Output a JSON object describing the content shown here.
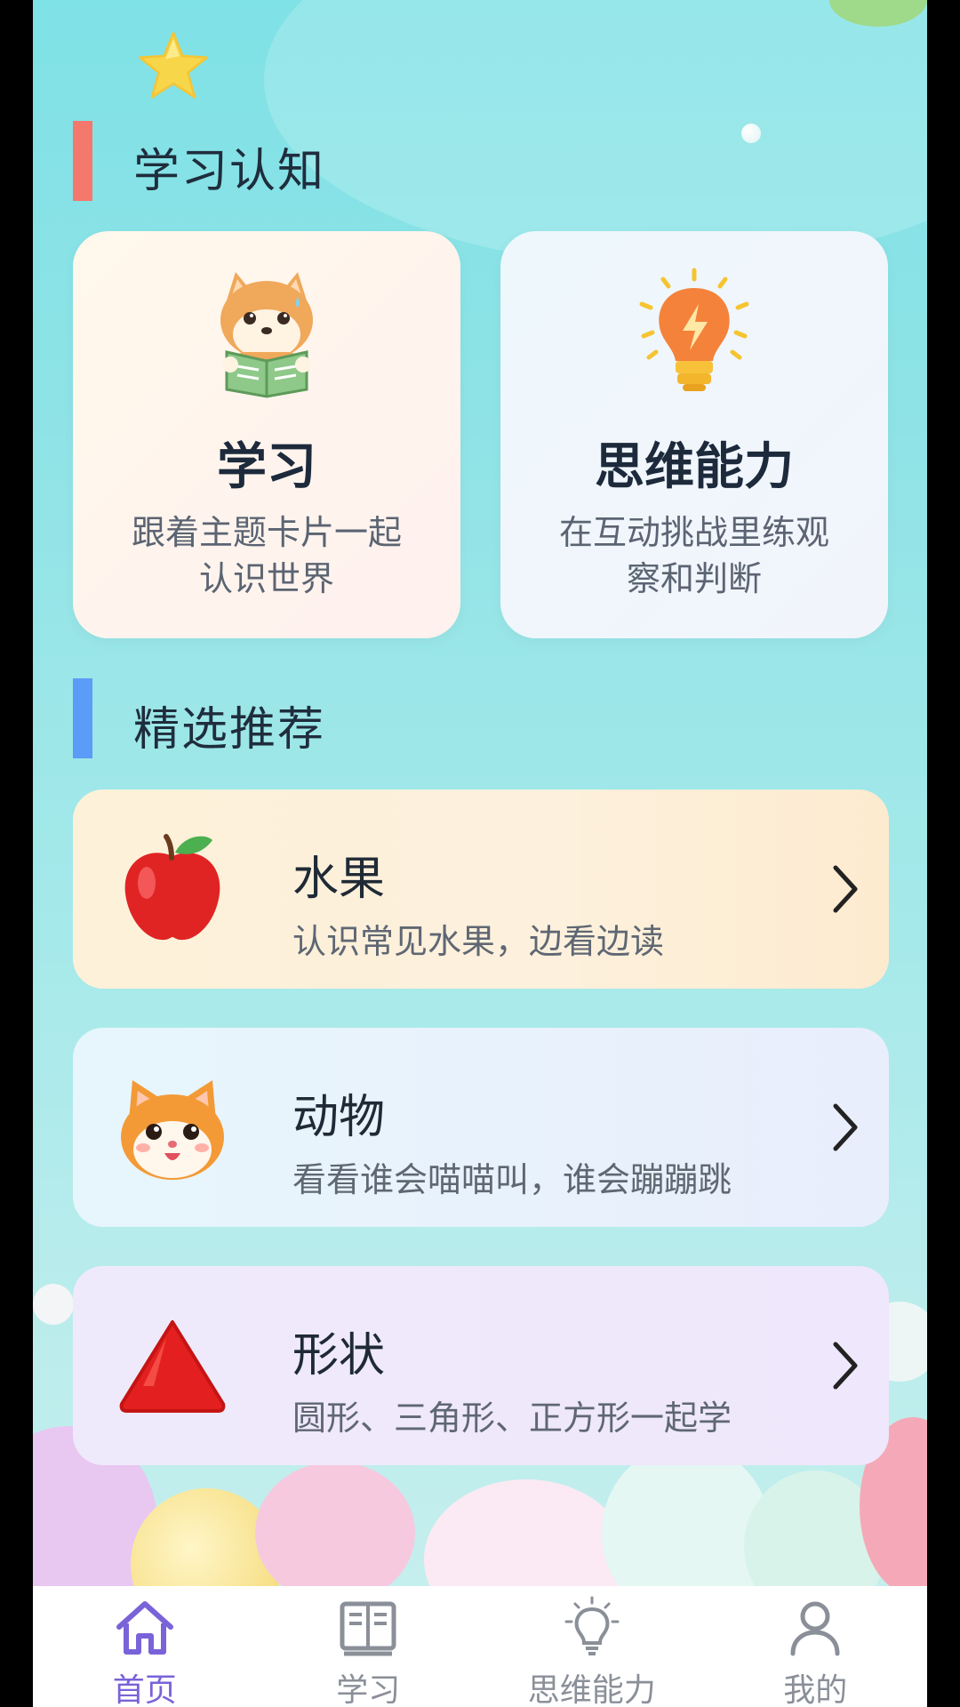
{
  "sections": {
    "learning": {
      "title": "学习认知",
      "bar_color": "#f4786b"
    },
    "featured": {
      "title": "精选推荐",
      "bar_color": "#5b9cf8"
    }
  },
  "category_cards": [
    {
      "title": "学习",
      "desc": "跟着主题卡片一起认识世界",
      "icon": "shiba-dog-reading-icon"
    },
    {
      "title": "思维能力",
      "desc": "在互动挑战里练观察和判断",
      "icon": "lightbulb-icon"
    }
  ],
  "recommendations": [
    {
      "title": "水果",
      "desc": "认识常见水果，边看边读",
      "icon": "apple-icon"
    },
    {
      "title": "动物",
      "desc": "看看谁会喵喵叫，谁会蹦蹦跳",
      "icon": "cat-face-icon"
    },
    {
      "title": "形状",
      "desc": "圆形、三角形、正方形一起学",
      "icon": "triangle-icon"
    }
  ],
  "tabbar": {
    "items": [
      {
        "label": "首页",
        "icon": "home-icon",
        "active": true
      },
      {
        "label": "学习",
        "icon": "book-icon",
        "active": false
      },
      {
        "label": "思维能力",
        "icon": "lightbulb-icon",
        "active": false
      },
      {
        "label": "我的",
        "icon": "user-icon",
        "active": false
      }
    ]
  },
  "colors": {
    "accent": "#7a63d8",
    "background_top": "#7fe2e6",
    "background_bottom": "#c9f0ee"
  }
}
